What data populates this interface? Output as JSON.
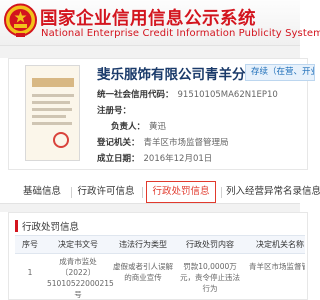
{
  "header": {
    "title_cn": "国家企业信用信息公示系统",
    "title_en": "National Enterprise Credit Information Publicity System"
  },
  "company": {
    "name": "斐乐服饰有限公司青羊分公司",
    "status": "存续（在营、开业、在册）",
    "fields": [
      {
        "label": "统一社会信用代码：",
        "value": "91510105MA62N1EP10"
      },
      {
        "label": "注册号：",
        "value": ""
      },
      {
        "label": "负责人：",
        "value": "黄迅"
      },
      {
        "label": "登记机关：",
        "value": "青羊区市场监督管理局"
      },
      {
        "label": "成立日期：",
        "value": "2016年12月01日"
      }
    ]
  },
  "tabs": [
    {
      "label": "基础信息"
    },
    {
      "label": "行政许可信息"
    },
    {
      "label": "行政处罚信息"
    },
    {
      "label": "列入经营异常名录信息"
    }
  ],
  "penalty": {
    "section_title": "行政处罚信息",
    "columns": [
      "序号",
      "决定书文号",
      "违法行为类型",
      "行政处罚内容",
      "决定机关名称"
    ],
    "rows": [
      [
        "1",
        "成青市监处〔2022〕51010522000215号",
        "虚假或者引人误解的商业宣传",
        "罚款10,0000万元，责令停止违法行为",
        "青羊区市场监督管理局"
      ]
    ]
  },
  "colors": {
    "brand_red": "#d3141e",
    "company_blue": "#1a3a6a",
    "status_blue": "#1b6db8"
  }
}
